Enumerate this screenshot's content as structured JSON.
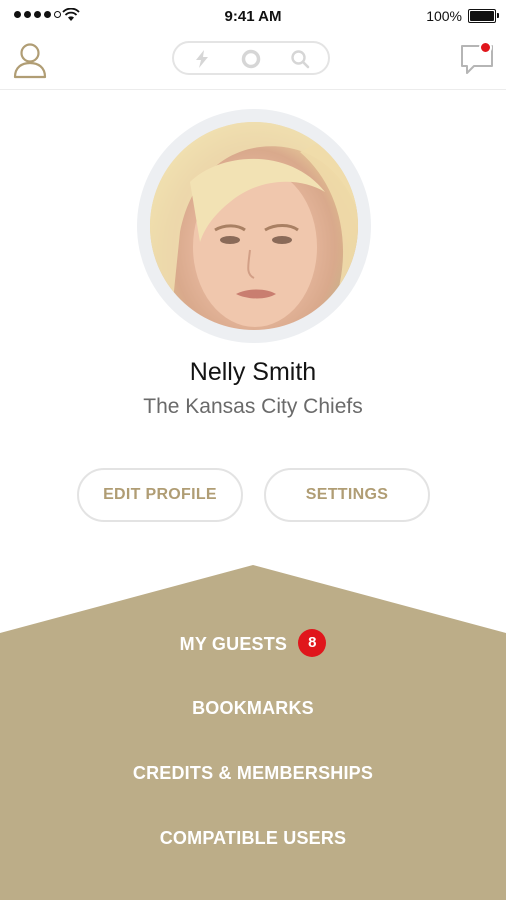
{
  "status_bar": {
    "time": "9:41 AM",
    "battery_percent": "100%",
    "signal_bars": 4
  },
  "nav": {
    "left_icon": "person-icon",
    "segment_icons": [
      "bolt-icon",
      "circle-icon",
      "search-icon"
    ],
    "right_icon": "chat-bubble-icon",
    "has_notification": true
  },
  "profile": {
    "name": "Nelly Smith",
    "team": "The Kansas City Chiefs",
    "edit_label": "EDIT PROFILE",
    "settings_label": "SETTINGS"
  },
  "menu": {
    "items": [
      {
        "label": "MY GUESTS",
        "badge": "8"
      },
      {
        "label": "BOOKMARKS"
      },
      {
        "label": "CREDITS & MEMBERSHIPS"
      },
      {
        "label": "COMPATIBLE USERS"
      }
    ]
  },
  "colors": {
    "accent": "#b09d74",
    "menu_background": "#bcad88",
    "badge": "#e0161c"
  }
}
